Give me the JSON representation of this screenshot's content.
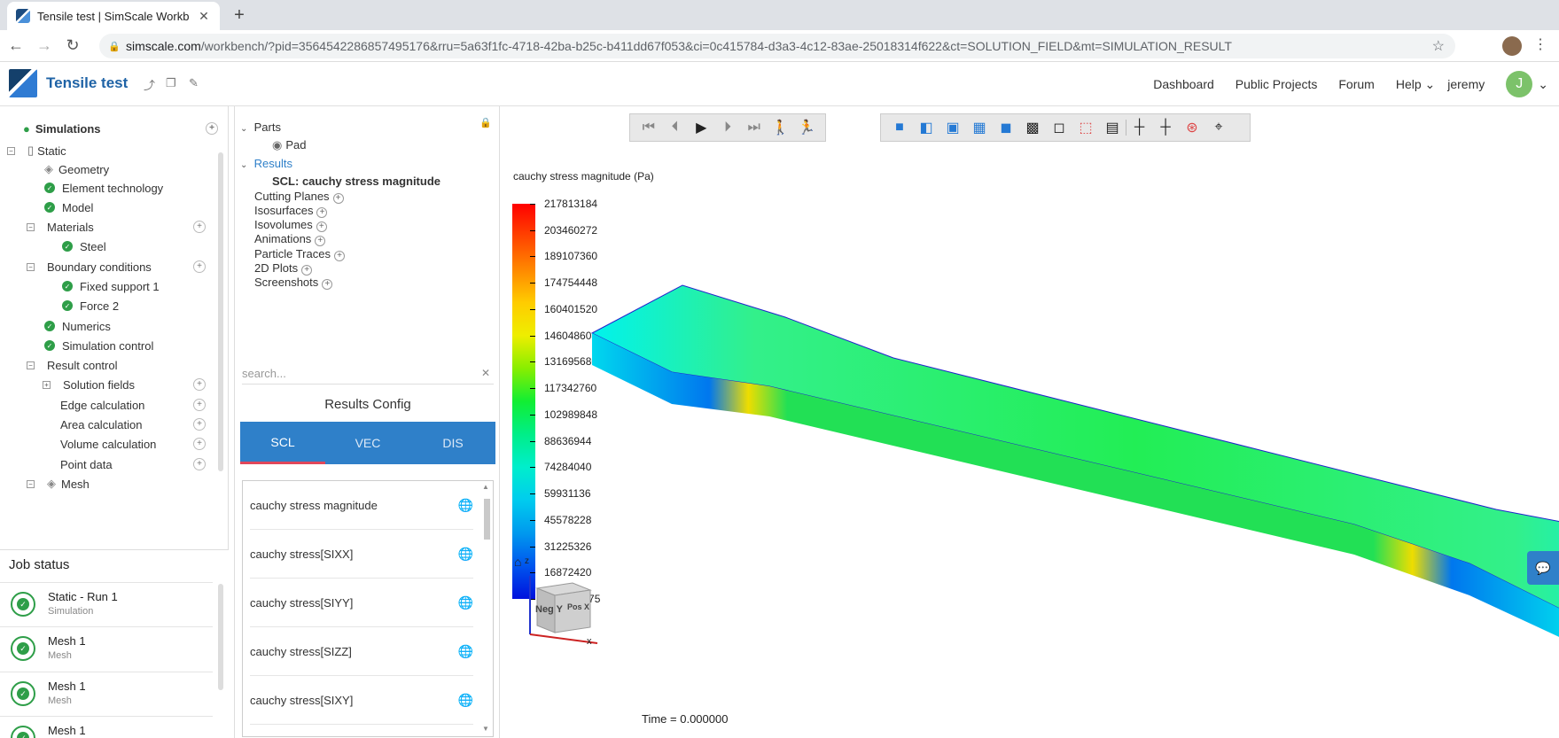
{
  "browser": {
    "tab_title": "Tensile test | SimScale Workb",
    "url_domain": "simscale.com",
    "url_rest": "/workbench/?pid=3564542286857495176&rru=5a63f1fc-4718-42ba-b25c-b411dd67f053&ci=0c415784-d3a3-4c12-83ae-25018314f622&ct=SOLUTION_FIELD&mt=SIMULATION_RESULT"
  },
  "app": {
    "project_title": "Tensile test",
    "nav": [
      "Dashboard",
      "Public Projects",
      "Forum",
      "Help",
      "jeremy"
    ],
    "avatar_letter": "J"
  },
  "left_tree": {
    "root": "Simulations",
    "items": [
      "Static",
      "Geometry",
      "Element technology",
      "Model",
      "Materials",
      "Steel",
      "Boundary conditions",
      "Fixed support 1",
      "Force 2",
      "Numerics",
      "Simulation control",
      "Result control",
      "Solution fields",
      "Edge calculation",
      "Area calculation",
      "Volume calculation",
      "Point data",
      "Mesh"
    ]
  },
  "job_status": {
    "title": "Job status",
    "jobs": [
      {
        "name": "Static - Run 1",
        "type": "Simulation"
      },
      {
        "name": "Mesh 1",
        "type": "Mesh"
      },
      {
        "name": "Mesh 1",
        "type": "Mesh"
      },
      {
        "name": "Mesh 1",
        "type": "Mesh"
      }
    ]
  },
  "post_tree": {
    "parts": "Parts",
    "pad": "Pad",
    "results": "Results",
    "scl": "SCL: cauchy stress magnitude",
    "items": [
      "Cutting Planes",
      "Isosurfaces",
      "Isovolumes",
      "Animations",
      "Particle Traces",
      "2D Plots",
      "Screenshots"
    ],
    "search_placeholder": "search..."
  },
  "results_config": {
    "title": "Results Config",
    "tabs": [
      "SCL",
      "VEC",
      "DIS"
    ],
    "fields": [
      "cauchy stress magnitude",
      "cauchy stress[SIXX]",
      "cauchy stress[SIYY]",
      "cauchy stress[SIZZ]",
      "cauchy stress[SIXY]"
    ]
  },
  "viewer": {
    "legend_title": "cauchy stress magnitude (Pa)",
    "legend_values": [
      "217813184",
      "203460272",
      "189107360",
      "174754448",
      "160401520",
      "146048608",
      "131695680",
      "117342760",
      "102989848",
      "88636944",
      "74284040",
      "59931136",
      "45578228",
      "31225326",
      "16872420",
      "2519513.75"
    ],
    "time_label": "Time = 0.000000",
    "cube_faces": [
      "Neg Y",
      "Pos X"
    ],
    "axis_labels": [
      "z",
      "x"
    ]
  }
}
